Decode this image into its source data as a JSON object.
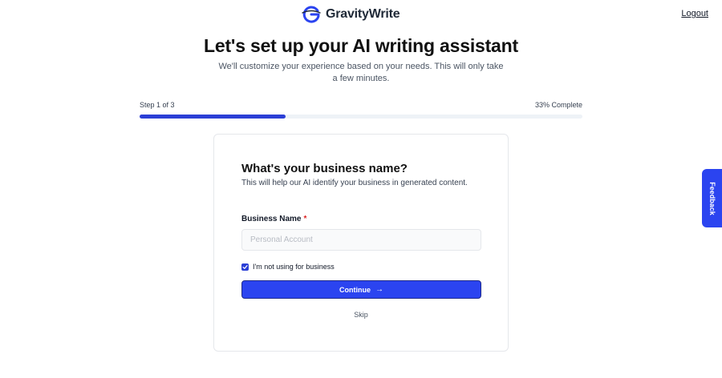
{
  "header": {
    "brand": "GravityWrite",
    "logout_label": "Logout"
  },
  "intro": {
    "title": "Let's set up your AI writing assistant",
    "subtitle": "We'll customize your experience based on your needs. This will only take a few minutes."
  },
  "progress": {
    "step_label": "Step 1 of 3",
    "percent_label": "33% Complete",
    "fraction": 0.33
  },
  "form": {
    "title": "What's your business name?",
    "description": "This will help our AI identify your business in generated content.",
    "field_label": "Business Name",
    "required_mark": "*",
    "input_placeholder": "Personal Account",
    "input_value": "",
    "checkbox_label": "I'm not using for business",
    "checkbox_checked": true,
    "continue_label": "Continue",
    "continue_icon": "arrow-right-icon",
    "skip_label": "Skip"
  },
  "feedback": {
    "label": "Feedback"
  },
  "colors": {
    "accent": "#2b44f0",
    "progress_fill": "#2b3fd6",
    "required": "#dc2626"
  }
}
